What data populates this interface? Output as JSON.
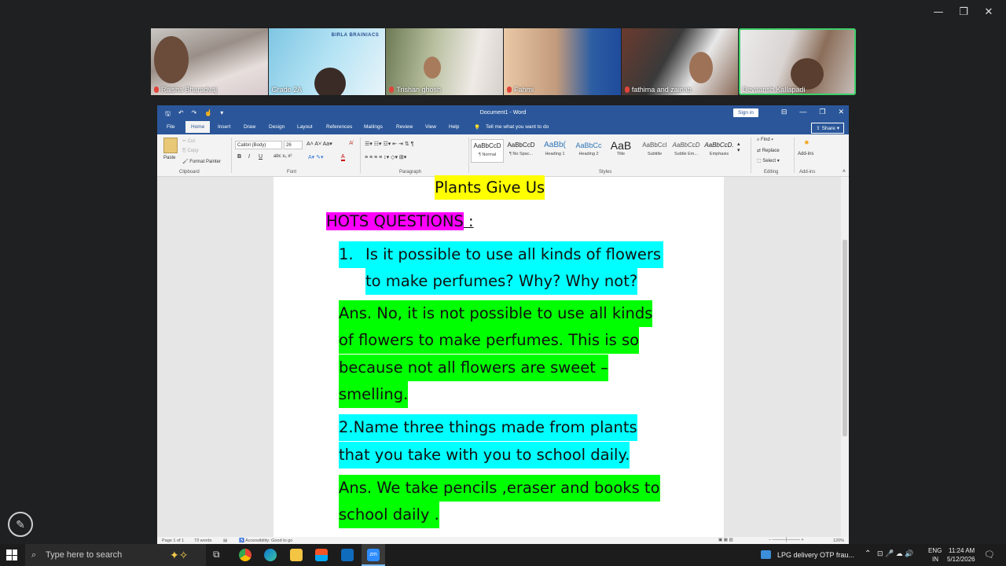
{
  "window_controls": {
    "minimize": "—",
    "restore": "❐",
    "close": "✕"
  },
  "participants": [
    {
      "name": "Raisha Bharadvaj"
    },
    {
      "name": "Grade 2A"
    },
    {
      "name": "Trishan ghosh"
    },
    {
      "name": "Fahmi"
    },
    {
      "name": "fathima and zainab"
    },
    {
      "name": "Devaansh Kallapadi"
    }
  ],
  "tile2_logo": "BIRLA BRAINIACS",
  "word": {
    "title": "Document1 - Word",
    "signin": "Sign in",
    "share": "Share",
    "tabs": [
      "File",
      "Home",
      "Insert",
      "Draw",
      "Design",
      "Layout",
      "References",
      "Mailings",
      "Review",
      "View",
      "Help"
    ],
    "tell_me": "Tell me what you want to do",
    "clipboard": {
      "paste": "Paste",
      "cut": "Cut",
      "copy": "Copy",
      "format_painter": "Format Painter",
      "label": "Clipboard"
    },
    "font": {
      "name": "Calibri (Body)",
      "size": "26",
      "label": "Font"
    },
    "paragraph_label": "Paragraph",
    "styles": [
      {
        "sample": "AaBbCcD",
        "name": "¶ Normal"
      },
      {
        "sample": "AaBbCcD",
        "name": "¶ No Spac..."
      },
      {
        "sample": "AaBb(",
        "name": "Heading 1"
      },
      {
        "sample": "AaBbCc",
        "name": "Heading 2"
      },
      {
        "sample": "AaB",
        "name": "Title"
      },
      {
        "sample": "AaBbCcI",
        "name": "Subtitle"
      },
      {
        "sample": "AaBbCcD",
        "name": "Subtle Em..."
      },
      {
        "sample": "AaBbCcD.",
        "name": "Emphasis"
      }
    ],
    "styles_label": "Styles",
    "editing": {
      "find": "Find",
      "replace": "Replace",
      "select": "Select",
      "label": "Editing"
    },
    "addins": {
      "button": "Add-ins",
      "label": "Add-ins"
    },
    "status": {
      "page": "Page 1 of 1",
      "words": "73 words",
      "accessibility": "Accessibility: Good to go",
      "zoom": "120%"
    }
  },
  "document": {
    "title": "Plants Give Us",
    "hots": "HOTS QUESTIONS",
    "hots_colon": " :",
    "q1_num": "1.",
    "q1_line1": "Is it possible to use all kinds of flowers",
    "q1_line2": "to make perfumes? Why? Why not?",
    "a1_line1": "Ans. No, it is not possible to use all kinds",
    "a1_line2": "of flowers to make perfumes. This is so",
    "a1_line3": "because not all flowers are sweet –",
    "a1_line4": "smelling.",
    "q2_line1": "2.Name three things made from plants",
    "q2_line2": "that you take with you to school daily.",
    "a2_line1": "Ans. We take pencils ,eraser and books to",
    "a2_line2": "school daily ."
  },
  "taskbar": {
    "search_placeholder": "Type here to search",
    "notification": "LPG delivery OTP frau...",
    "lang1": "ENG",
    "lang2": "IN",
    "time": "11:24 AM",
    "date": "5/12/2026"
  }
}
